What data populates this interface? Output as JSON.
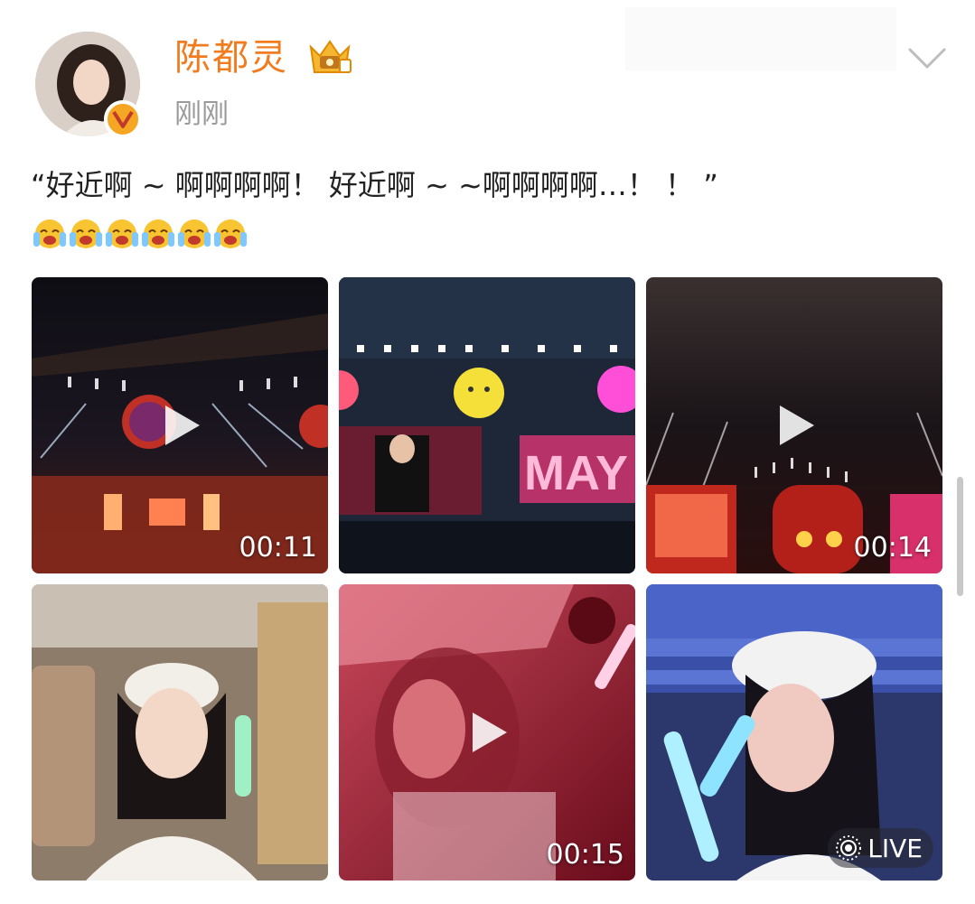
{
  "post": {
    "author": "陈都灵",
    "timestamp": "刚刚",
    "text": "“好近啊 ~ 啊啊啊啊！ 好近啊 ~  ~啊啊啊啊…！ ！ ”",
    "emoji_count": 6,
    "emoji_icon": "crying-laughing-emoji",
    "verified_icon": "verified-v-badge-icon",
    "member_icon": "vip-crown-icon"
  },
  "media": [
    {
      "type": "video",
      "duration": "00:11",
      "icon": "play-icon"
    },
    {
      "type": "video",
      "duration": "",
      "icon": "play-icon"
    },
    {
      "type": "video",
      "duration": "00:14",
      "icon": "play-icon"
    },
    {
      "type": "photo"
    },
    {
      "type": "video",
      "duration": "00:15",
      "icon": "play-icon"
    },
    {
      "type": "live-photo",
      "badge": "LIVE",
      "icon": "live-photo-icon"
    }
  ],
  "colors": {
    "username": "#f07c1f",
    "timestamp": "#9a9a9a",
    "text": "#222222"
  }
}
